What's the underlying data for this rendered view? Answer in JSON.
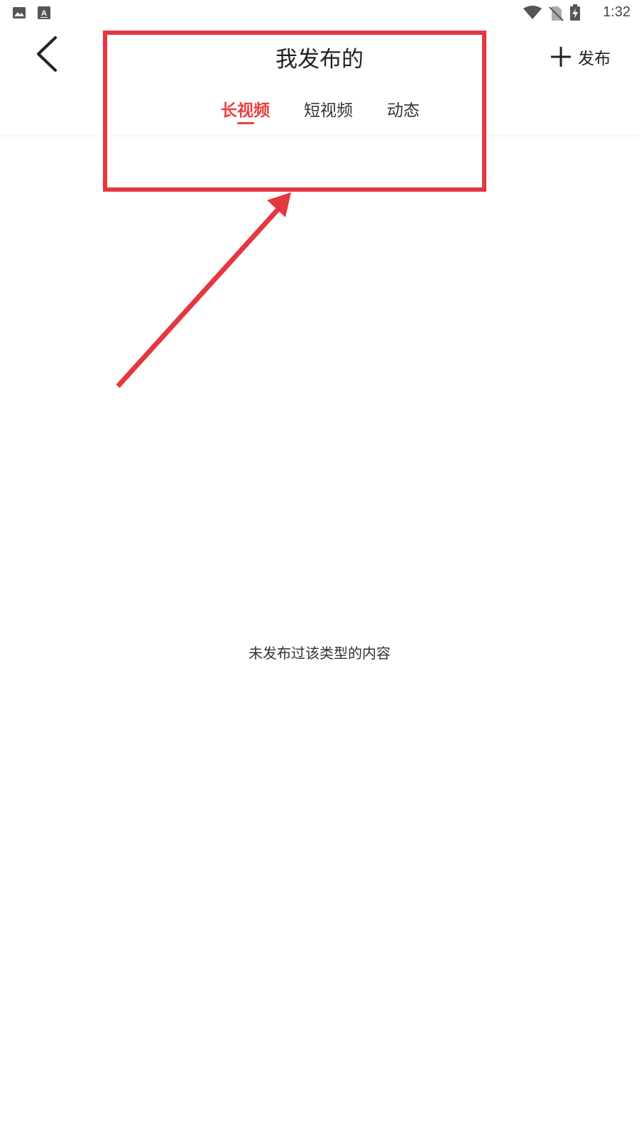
{
  "status_bar": {
    "time": "1:32",
    "left_icons": [
      "image-notification-icon",
      "text-a-notification-icon"
    ],
    "right_icons": [
      "wifi-icon",
      "no-sim-icon",
      "battery-charging-icon"
    ]
  },
  "header": {
    "title": "我发布的",
    "back_icon": "back-arrow-icon",
    "publish": {
      "icon": "plus-icon",
      "label": "发布"
    }
  },
  "tabs": [
    {
      "label": "长视频",
      "active": true
    },
    {
      "label": "短视频",
      "active": false
    },
    {
      "label": "动态",
      "active": false
    }
  ],
  "content": {
    "empty_message": "未发布过该类型的内容"
  },
  "colors": {
    "accent": "#e8403f",
    "annotation": "#e5373f",
    "text": "#222222",
    "divider": "#eeeeee"
  }
}
